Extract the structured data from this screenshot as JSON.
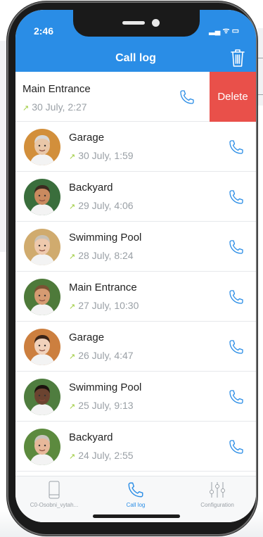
{
  "status": {
    "time": "2:46"
  },
  "header": {
    "title": "Call log"
  },
  "swiped_row": {
    "name": "Main Entrance",
    "date": "30 July, 2:27",
    "delete_label": "Delete"
  },
  "rows": [
    {
      "name": "Garage",
      "date": "30 July, 1:59",
      "skin": "#e9c7a8",
      "hair": "#d8d8d8",
      "bg": "#d28f3b"
    },
    {
      "name": "Backyard",
      "date": "29 July, 4:06",
      "skin": "#c98a5f",
      "hair": "#3b2a1f",
      "bg": "#3a6e3c"
    },
    {
      "name": "Swimming Pool",
      "date": "28 July, 8:24",
      "skin": "#eec9ad",
      "hair": "#c9c2b7",
      "bg": "#d0ab6e"
    },
    {
      "name": "Main Entrance",
      "date": "27 July, 10:30",
      "skin": "#d59b72",
      "hair": "#7a5233",
      "bg": "#4e7a3a"
    },
    {
      "name": "Garage",
      "date": "26 July, 4:47",
      "skin": "#f1d2bb",
      "hair": "#3a2418",
      "bg": "#cc7f3f"
    },
    {
      "name": "Swimming Pool",
      "date": "25 July, 9:13",
      "skin": "#6b4330",
      "hair": "#1b120d",
      "bg": "#4f7d3f"
    },
    {
      "name": "Backyard",
      "date": "24 July, 2:55",
      "skin": "#e7b89a",
      "hair": "#c8c4bc",
      "bg": "#5c8a3e"
    }
  ],
  "tabs": [
    {
      "label": "C0-Osobni_vytah...",
      "icon": "phone-device-icon"
    },
    {
      "label": "Call log",
      "icon": "phone-handset-icon"
    },
    {
      "label": "Configuration",
      "icon": "sliders-icon"
    }
  ],
  "colors": {
    "accent": "#2a8de6",
    "delete": "#e9504a",
    "arrow": "#9ccb3b"
  }
}
